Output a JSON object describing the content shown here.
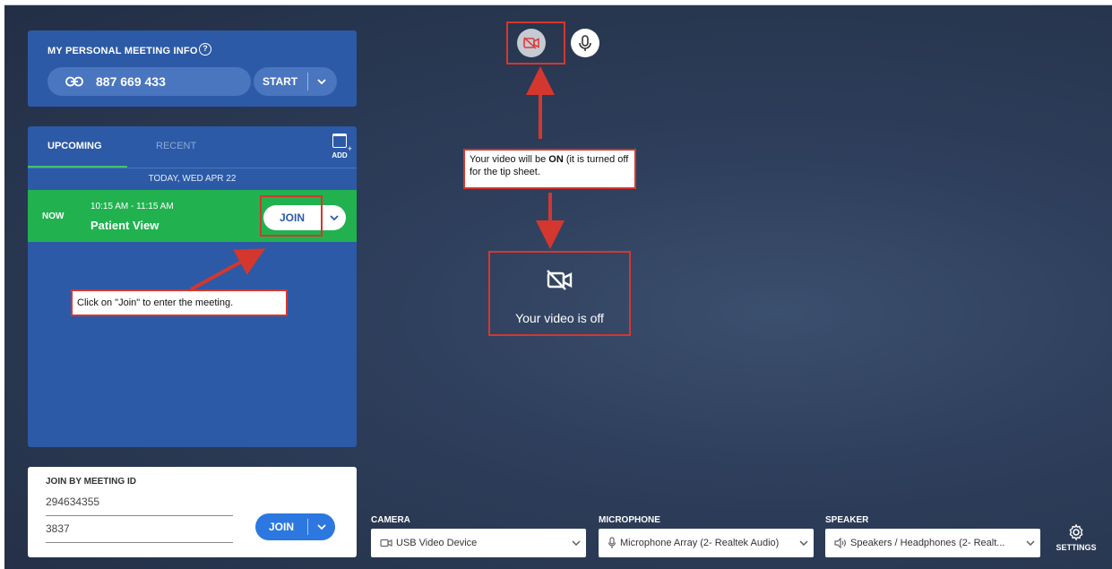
{
  "personal_meeting": {
    "title": "MY PERSONAL MEETING INFO",
    "help_glyph": "?",
    "meeting_number": "887 669 433",
    "start_label": "START"
  },
  "meetings_panel": {
    "tabs": [
      {
        "label": "UPCOMING",
        "active": true
      },
      {
        "label": "RECENT",
        "active": false
      }
    ],
    "add_label": "ADD",
    "date_header": "TODAY, WED APR 22",
    "meetings": [
      {
        "status": "NOW",
        "time": "10:15 AM - 11:15 AM",
        "title": "Patient View",
        "join_label": "JOIN"
      }
    ]
  },
  "join_by_id": {
    "title": "JOIN BY MEETING ID",
    "meeting_id_value": "294634355",
    "password_value": "3837",
    "join_label": "JOIN"
  },
  "media": {
    "video_off_text": "Your video is off"
  },
  "callouts": {
    "video_note_before": "Your video will be ",
    "video_note_bold": "ON",
    "video_note_after": " (it is turned off for the tip sheet.",
    "join_note": "Click on \"Join\" to enter the meeting."
  },
  "devices": {
    "camera": {
      "label": "CAMERA",
      "value": "USB Video Device"
    },
    "microphone": {
      "label": "MICROPHONE",
      "value": "Microphone Array (2- Realtek Audio)"
    },
    "speaker": {
      "label": "SPEAKER",
      "value": "Speakers / Headphones (2- Realt..."
    }
  },
  "settings_label": "SETTINGS",
  "colors": {
    "panel_blue": "#2c5aa6",
    "now_green": "#21b24f",
    "join_blue": "#2c78e0",
    "annotation_red": "#d4372e",
    "video_off_red": "#e03b3b"
  },
  "icons": {
    "link": "link-icon",
    "calendar_add": "calendar-add-icon",
    "camera_off": "camera-off-icon",
    "microphone": "microphone-icon",
    "settings": "gear-icon",
    "chevron": "chevron-down-icon"
  }
}
